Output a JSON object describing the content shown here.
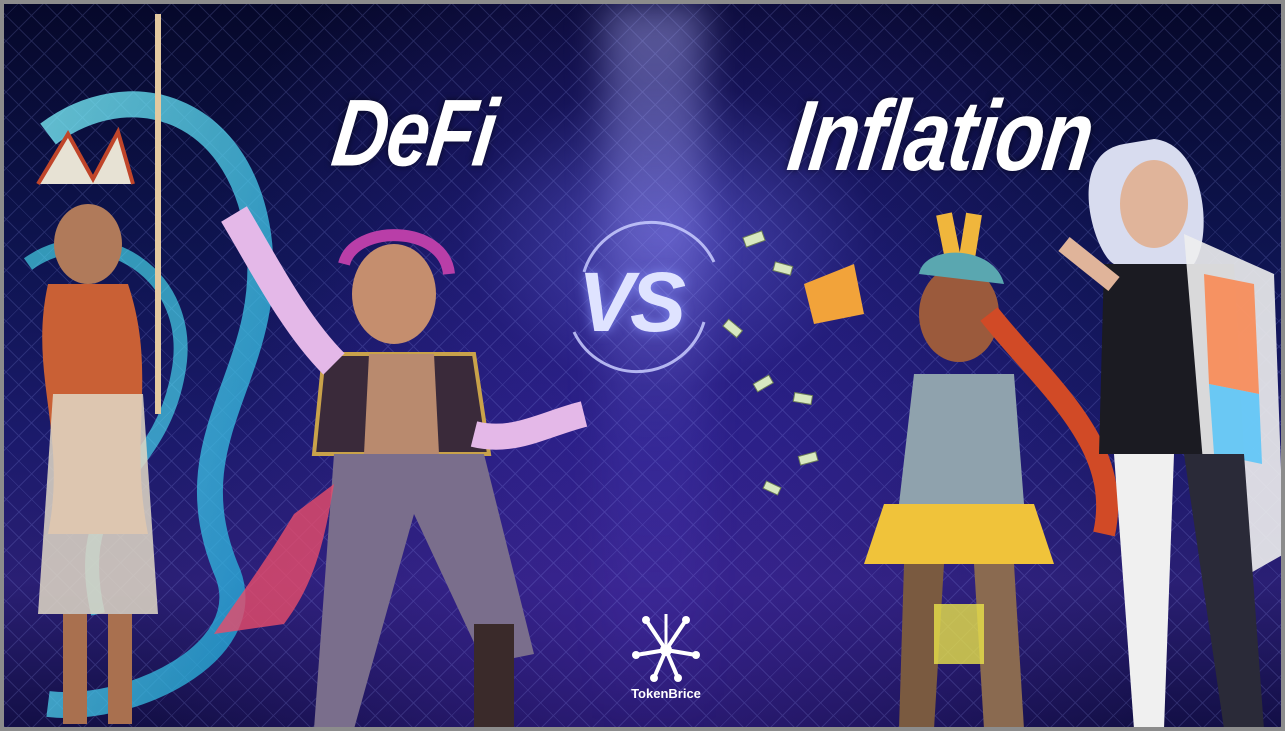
{
  "left_title": "DeFi",
  "right_title": "Inflation",
  "versus": "VS",
  "brand": {
    "name": "TokenBrice"
  },
  "colors": {
    "background_dark": "#0e1450",
    "background_glow": "#7868ff",
    "title": "#ffffff",
    "cyan_glow": "#39e6ff"
  },
  "figures": [
    {
      "name": "feathered-shaman-character",
      "side": "left"
    },
    {
      "name": "flower-crowned-dancer-character",
      "side": "left"
    },
    {
      "name": "money-gun-character",
      "side": "right"
    },
    {
      "name": "silver-haired-character",
      "side": "right"
    }
  ]
}
